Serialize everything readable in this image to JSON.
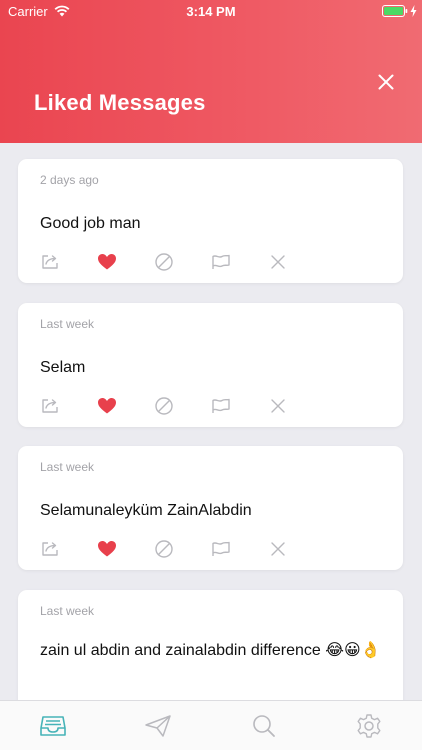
{
  "status_bar": {
    "carrier": "Carrier",
    "time": "3:14 PM"
  },
  "header": {
    "title": "Liked Messages"
  },
  "colors": {
    "accent": "#ea4550",
    "heart": "#e8404c",
    "icon_gray": "#b9b9be",
    "tab_active": "#46b3b8"
  },
  "messages": [
    {
      "time": "2 days ago",
      "text": "Good job man"
    },
    {
      "time": "Last week",
      "text": "Selam"
    },
    {
      "time": "Last week",
      "text": "Selamunaleyküm ZainAlabdin"
    },
    {
      "time": "Last week",
      "text": "zain ul abdin and zainalabdin difference 😂😀👌"
    }
  ],
  "actions": [
    "share-icon",
    "heart-icon",
    "block-icon",
    "flag-icon",
    "delete-icon"
  ],
  "tabs": [
    {
      "name": "inbox-icon",
      "active": true
    },
    {
      "name": "send-icon",
      "active": false
    },
    {
      "name": "search-icon",
      "active": false
    },
    {
      "name": "settings-icon",
      "active": false
    }
  ]
}
